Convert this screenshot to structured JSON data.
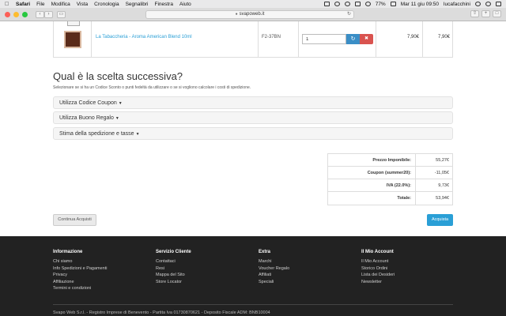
{
  "menubar": {
    "app": "Safari",
    "items": [
      "File",
      "Modifica",
      "Vista",
      "Cronologia",
      "Segnalibri",
      "Finestra",
      "Aiuto"
    ],
    "battery": "77%",
    "datetime": "Mar 11 giu  09:50",
    "user": "lucafacchini"
  },
  "browser": {
    "url": "svapoweb.it"
  },
  "cart": {
    "product_name": "La Tabaccheria - Aroma American Blend 10ml",
    "product_code": "F2-37BN",
    "quantity": "1",
    "unit_price": "7,90€",
    "total_price": "7,90€"
  },
  "next_step": {
    "title": "Qual è la scelta successiva?",
    "subtitle": "Selezionare se si ha un Codice Sconto o punti fedeltà da utilizzare o se si vogliono calcolare i costi di spedizione.",
    "options": [
      {
        "label": "Utilizza Codice Coupon"
      },
      {
        "label": "Utilizza Buono Regalo"
      },
      {
        "label": "Stima della spedizione e tasse"
      }
    ]
  },
  "totals": [
    {
      "label": "Prezzo Imponibile:",
      "value": "55,27€"
    },
    {
      "label": "Coupon (summer20):",
      "value": "-11,05€"
    },
    {
      "label": "IVA (22.0%):",
      "value": "9,73€"
    },
    {
      "label": "Totale:",
      "value": "53,94€"
    }
  ],
  "actions": {
    "continue_label": "Continua Acquisti",
    "checkout_label": "Acquista"
  },
  "footer": {
    "columns": [
      {
        "heading": "Informazione",
        "links": [
          "Chi siamo",
          "Info Spedizioni e Pagamenti",
          "Privacy",
          "Affiliazione",
          "Termini e condizioni"
        ]
      },
      {
        "heading": "Servizio Cliente",
        "links": [
          "Contattaci",
          "Resi",
          "Mappa del Sito",
          "Store Locator"
        ]
      },
      {
        "heading": "Extra",
        "links": [
          "Marchi",
          "Voucher Regalo",
          "Affiliati",
          "Speciali"
        ]
      },
      {
        "heading": "Il Mio Account",
        "links": [
          "Il Mio Account",
          "Storico Ordini",
          "Lista dei Desideri",
          "Newsletter"
        ]
      }
    ],
    "copyright": "Svapo Web S.r.l. - Registro Imprese di Benevento - Partita Iva 01730870621 - Deposito Fiscale ADM: BNB10004"
  },
  "colors": {
    "link": "#2a9fd6",
    "checkout": "#2a9fd6",
    "refresh": "#3a8ec6",
    "remove": "#d9534f",
    "footer_bg": "#222222"
  }
}
